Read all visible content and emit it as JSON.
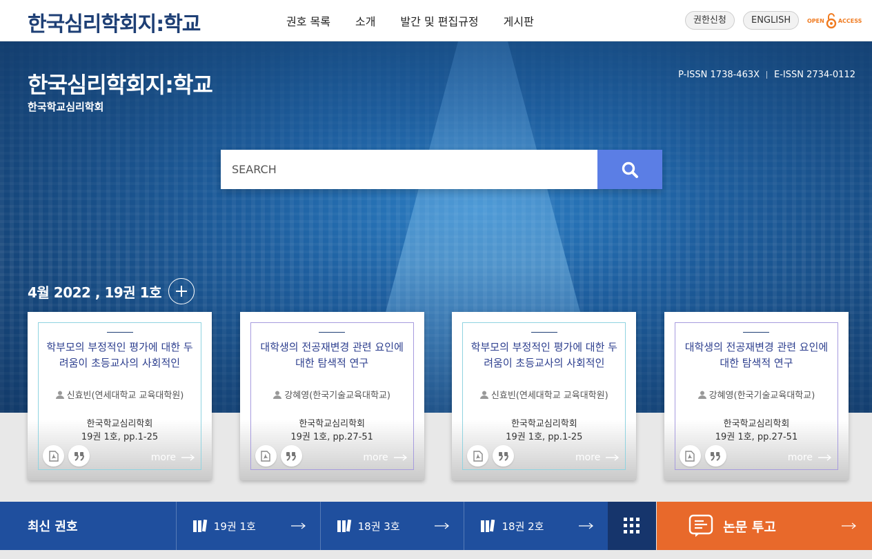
{
  "header": {
    "logo": "한국심리학회지:학교",
    "nav": [
      "권호 목록",
      "소개",
      "발간 및 편집규정",
      "게시판"
    ],
    "apply_label": "권한신청",
    "english_label": "ENGLISH",
    "oa_left": "OPEN",
    "oa_right": "ACCESS",
    "oa_icon": "open-access-lock-icon"
  },
  "hero": {
    "title": "한국심리학회지:학교",
    "subtitle": "한국학교심리학회",
    "pissn": "P-ISSN 1738-463X",
    "eissn": "E-ISSN 2734-0112",
    "search_placeholder": "SEARCH",
    "issue_label": "4월 2022 , 19권 1호"
  },
  "cards": [
    {
      "title": "학부모의 부정적인 평가에 대한 두려움이 초등교사의 사회적인",
      "author": "신효빈(연세대학교 교육대학원)",
      "publisher": "한국학교심리학회",
      "pages": "19권 1호, pp.1-25",
      "more": "more"
    },
    {
      "title": "대학생의 전공재변경 관련 요인에 대한 탐색적 연구",
      "author": "강혜영(한국기술교육대학교)",
      "publisher": "한국학교심리학회",
      "pages": "19권 1호, pp.27-51",
      "more": "more"
    },
    {
      "title": "학부모의 부정적인 평가에 대한 두려움이 초등교사의 사회적인",
      "author": "신효빈(연세대학교 교육대학원)",
      "publisher": "한국학교심리학회",
      "pages": "19권 1호, pp.1-25",
      "more": "more"
    },
    {
      "title": "대학생의 전공재변경 관련 요인에 대한 탐색적 연구",
      "author": "강혜영(한국기술교육대학교)",
      "publisher": "한국학교심리학회",
      "pages": "19권 1호, pp.27-51",
      "more": "more"
    }
  ],
  "bottom": {
    "latest_label": "최신 권호",
    "volumes": [
      "19권 1호",
      "18권 3호",
      "18권 2호"
    ],
    "submit_label": "논문 투고"
  },
  "colors": {
    "brand": "#1e3f75",
    "search_button": "#5b7ee5",
    "bar_blue": "#1f4f9e",
    "submit_orange": "#e8692b",
    "oa_orange": "#f07b20"
  }
}
